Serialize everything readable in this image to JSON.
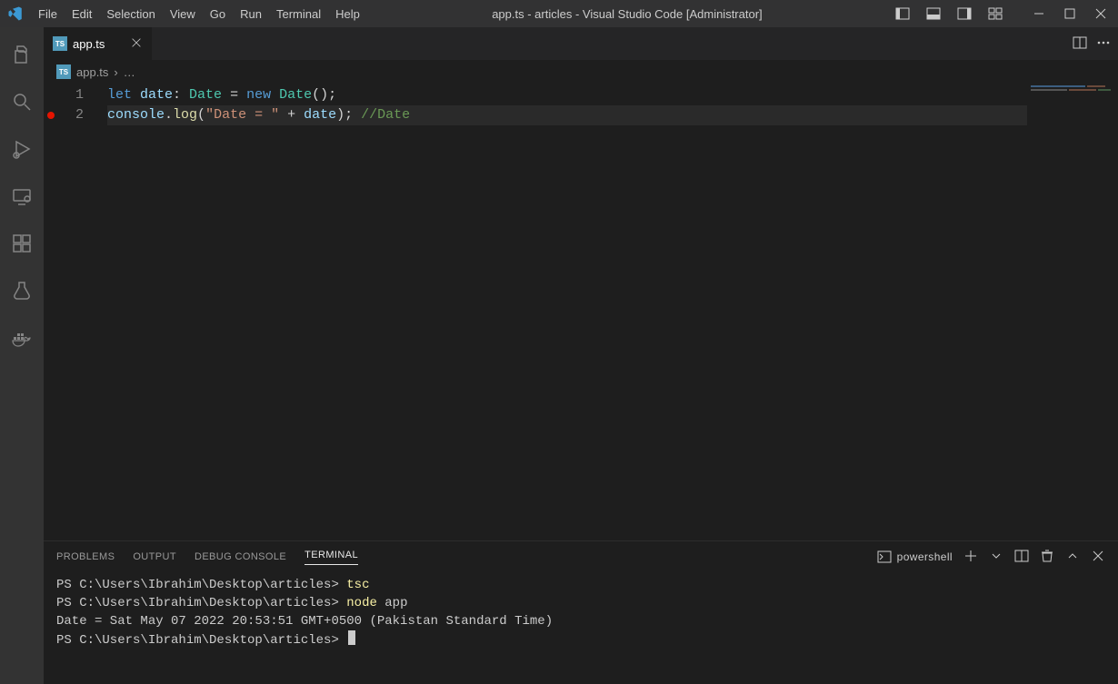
{
  "titlebar": {
    "menus": [
      "File",
      "Edit",
      "Selection",
      "View",
      "Go",
      "Run",
      "Terminal",
      "Help"
    ],
    "title": "app.ts - articles - Visual Studio Code [Administrator]"
  },
  "tabs": {
    "open": [
      {
        "label": "app.ts",
        "icon": "TS"
      }
    ]
  },
  "breadcrumb": {
    "icon": "TS",
    "file": "app.ts",
    "sep": "›",
    "more": "…"
  },
  "editor": {
    "lines": [
      {
        "n": "1",
        "bp": false
      },
      {
        "n": "2",
        "bp": true
      }
    ],
    "l1": {
      "let": "let ",
      "var": "date",
      "colon": ": ",
      "type": "Date",
      "eq": " = ",
      "new": "new ",
      "ctor": "Date",
      "call": "();"
    },
    "l2": {
      "obj": "console",
      "dot": ".",
      "fn": "log",
      "open": "(",
      "str": "\"Date = \"",
      "plus": " + ",
      "var": "date",
      "close": "); ",
      "comment": "//Date"
    }
  },
  "panel": {
    "tabs": [
      "PROBLEMS",
      "OUTPUT",
      "DEBUG CONSOLE",
      "TERMINAL"
    ],
    "active": 3,
    "shell": "powershell",
    "terminal": {
      "prompt": "PS C:\\Users\\Ibrahim\\Desktop\\articles> ",
      "cmd1": "tsc",
      "cmd2a": "node",
      "cmd2b": " app",
      "out": "Date = Sat May 07 2022 20:53:51 GMT+0500 (Pakistan Standard Time)"
    }
  }
}
